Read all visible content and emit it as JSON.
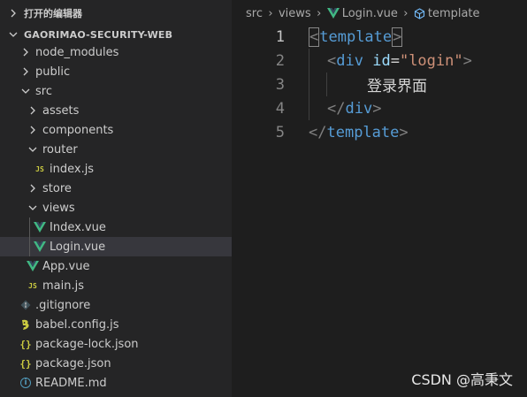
{
  "sidebar": {
    "open_editors_label": "打开的编辑器",
    "project_name": "GAORIMAO-SECURITY-WEB",
    "items": [
      {
        "label": "node_modules",
        "kind": "folder-closed",
        "depth": 1
      },
      {
        "label": "public",
        "kind": "folder-closed",
        "depth": 1
      },
      {
        "label": "src",
        "kind": "folder-open",
        "depth": 1
      },
      {
        "label": "assets",
        "kind": "folder-closed",
        "depth": 2
      },
      {
        "label": "components",
        "kind": "folder-closed",
        "depth": 2
      },
      {
        "label": "router",
        "kind": "folder-open",
        "depth": 2
      },
      {
        "label": "index.js",
        "kind": "js",
        "depth": 3
      },
      {
        "label": "store",
        "kind": "folder-closed",
        "depth": 2
      },
      {
        "label": "views",
        "kind": "folder-open",
        "depth": 2
      },
      {
        "label": "Index.vue",
        "kind": "vue",
        "depth": 3
      },
      {
        "label": "Login.vue",
        "kind": "vue",
        "depth": 3,
        "selected": true
      },
      {
        "label": "App.vue",
        "kind": "vue",
        "depth": 2
      },
      {
        "label": "main.js",
        "kind": "js",
        "depth": 2
      },
      {
        "label": ".gitignore",
        "kind": "git",
        "depth": 1
      },
      {
        "label": "babel.config.js",
        "kind": "babel",
        "depth": 1
      },
      {
        "label": "package-lock.json",
        "kind": "json",
        "depth": 1
      },
      {
        "label": "package.json",
        "kind": "json",
        "depth": 1
      },
      {
        "label": "README.md",
        "kind": "info",
        "depth": 1
      }
    ]
  },
  "breadcrumb": {
    "parts": [
      "src",
      "views",
      "Login.vue",
      "template"
    ]
  },
  "editor": {
    "line_numbers": [
      "1",
      "2",
      "3",
      "4",
      "5"
    ],
    "tokens": {
      "lt": "<",
      "gt": ">",
      "close_lt": "</",
      "eq": "=",
      "template": "template",
      "div": "div",
      "id_attr": "id",
      "id_value": "\"login\"",
      "content": "登录界面"
    }
  },
  "watermark": "CSDN @高秉文",
  "colors": {
    "sidebar_bg": "#252526",
    "editor_bg": "#1e1e1e",
    "selection_bg": "#37373d",
    "vue_green": "#41b883",
    "tag_blue": "#569cd6",
    "attr_blue": "#9cdcfe",
    "string_orange": "#ce9178"
  }
}
